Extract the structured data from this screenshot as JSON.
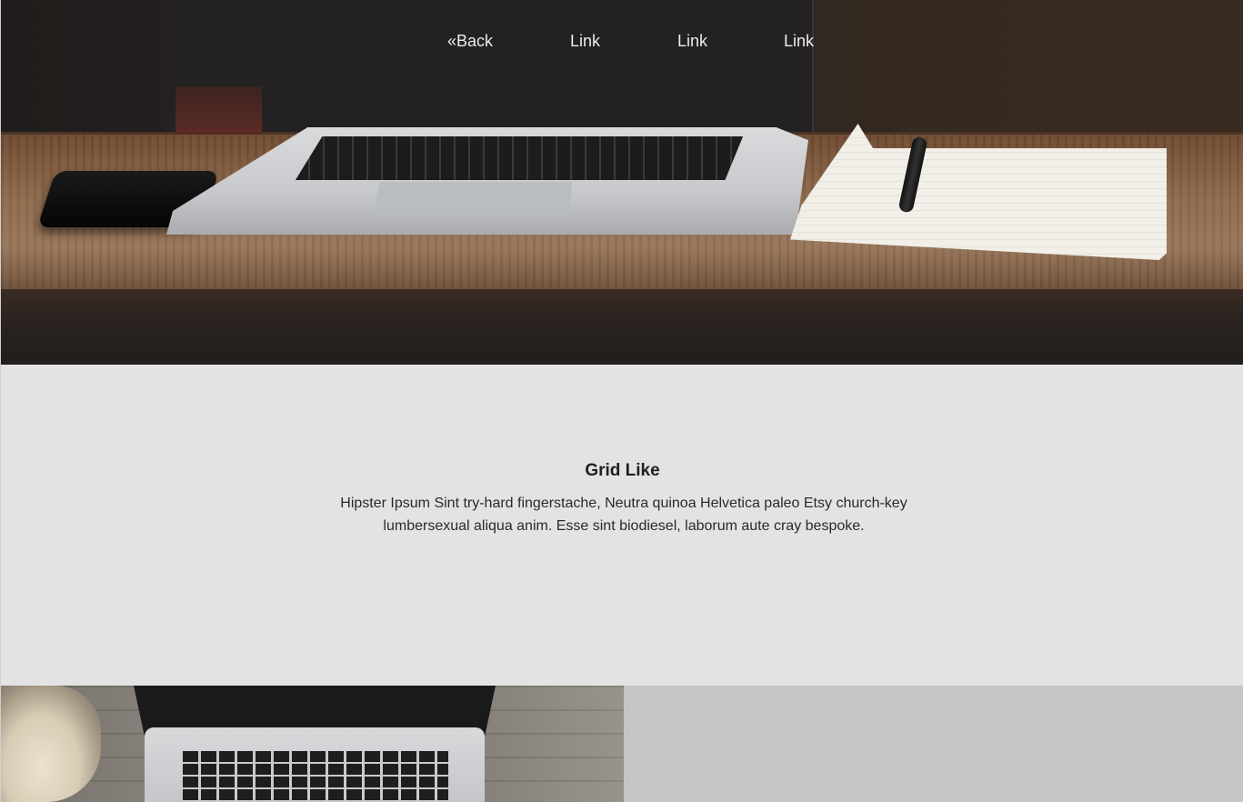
{
  "nav": {
    "back_label": "«Back",
    "links": [
      "Link",
      "Link",
      "Link"
    ]
  },
  "intro": {
    "heading": "Grid Like",
    "body": "Hipster Ipsum Sint try-hard fingerstache, Neutra quinoa Helvetica paleo Etsy church-key lumbersexual aliqua anim. Esse sint biodiesel, laborum aute cray bespoke."
  },
  "colors": {
    "page_background": "#e2e3e2",
    "nav_text": "#ececec",
    "body_text": "#2a2a2a",
    "grid_placeholder": "#c6c6c6"
  }
}
